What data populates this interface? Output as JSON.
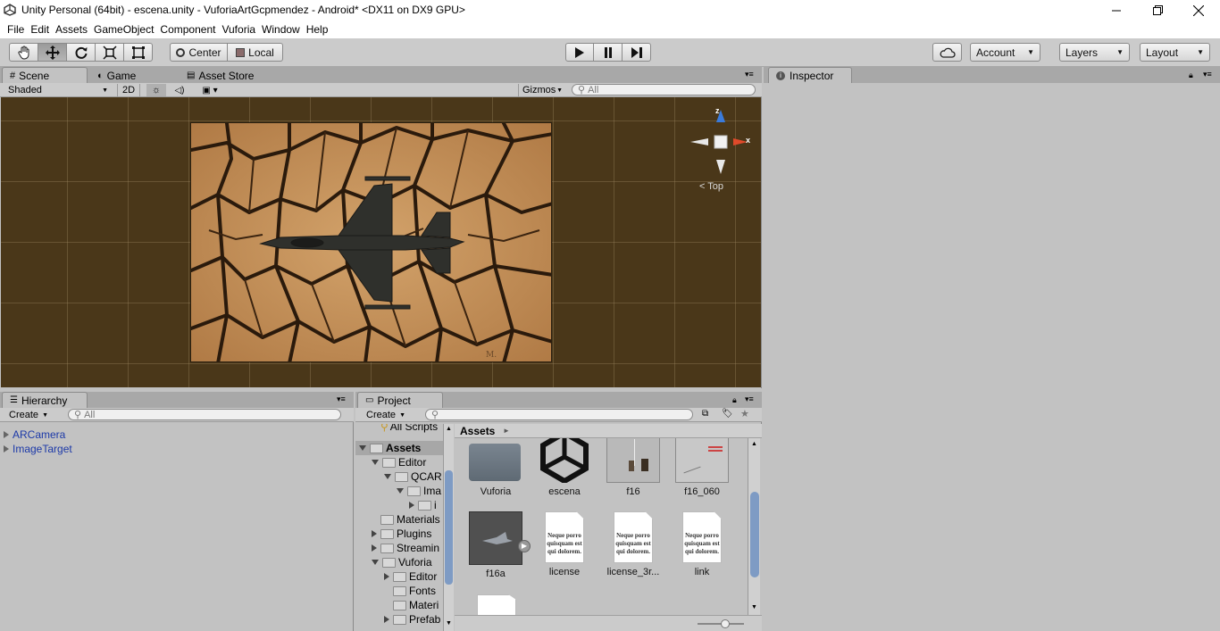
{
  "window": {
    "title": "Unity Personal (64bit) - escena.unity - VuforiaArtGcpmendez - Android* <DX11 on DX9 GPU>"
  },
  "menu": [
    "File",
    "Edit",
    "Assets",
    "GameObject",
    "Component",
    "Vuforia",
    "Window",
    "Help"
  ],
  "toolbar": {
    "pivot": "Center",
    "space": "Local",
    "account": "Account",
    "layers": "Layers",
    "layout": "Layout"
  },
  "scene_panel": {
    "tabs": [
      "Scene",
      "Game",
      "Asset Store"
    ],
    "shading": "Shaded",
    "mode_2d": "2D",
    "gizmos": "Gizmos",
    "search_placeholder": "All",
    "view_label": "Top",
    "axis_x": "x",
    "axis_z": "z"
  },
  "inspector": {
    "tab": "Inspector"
  },
  "hierarchy": {
    "tab": "Hierarchy",
    "create": "Create",
    "search_placeholder": "All",
    "items": [
      "ARCamera",
      "ImageTarget"
    ]
  },
  "project": {
    "tab": "Project",
    "create": "Create",
    "breadcrumb": "Assets",
    "tree": {
      "top_partial": "All Scripts",
      "assets": "Assets",
      "editor": "Editor",
      "qcar": "QCAR",
      "ima": "Ima",
      "i": "i",
      "materials": "Materials",
      "plugins": "Plugins",
      "streaming": "Streamin",
      "vuforia": "Vuforia",
      "v_editor": "Editor",
      "fonts": "Fonts",
      "materi": "Materi",
      "prefab": "Prefab"
    },
    "assets": [
      {
        "name": "Vuforia",
        "kind": "folder"
      },
      {
        "name": "escena",
        "kind": "unity"
      },
      {
        "name": "f16",
        "kind": "texture"
      },
      {
        "name": "f16_060",
        "kind": "texture2"
      },
      {
        "name": "f16a",
        "kind": "model"
      },
      {
        "name": "license",
        "kind": "doc"
      },
      {
        "name": "license_3r...",
        "kind": "doc"
      },
      {
        "name": "link",
        "kind": "doc"
      }
    ],
    "doc_preview": "Neque porro quisquam est qui dolorem."
  }
}
